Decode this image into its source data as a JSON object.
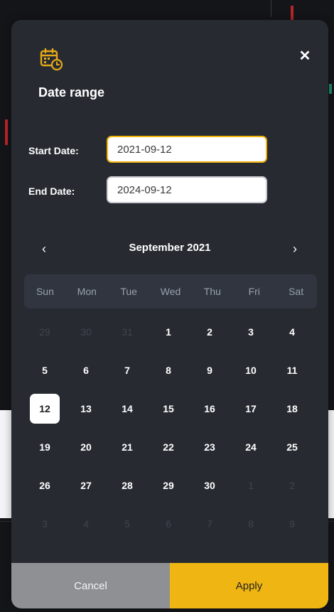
{
  "dialog": {
    "title": "Date range",
    "close_symbol": "✕",
    "icon": "calendar-clock-icon",
    "accent_color": "#f0b30d"
  },
  "start_date": {
    "label": "Start Date:",
    "value": "2021-09-12"
  },
  "end_date": {
    "label": "End Date:",
    "value": "2024-09-12"
  },
  "calendar": {
    "month_label": "September 2021",
    "prev_symbol": "‹",
    "next_symbol": "›",
    "weekdays": [
      "Sun",
      "Mon",
      "Tue",
      "Wed",
      "Thu",
      "Fri",
      "Sat"
    ],
    "weeks": [
      [
        "29",
        "30",
        "31",
        "1",
        "2",
        "3",
        "4"
      ],
      [
        "5",
        "6",
        "7",
        "8",
        "9",
        "10",
        "11"
      ],
      [
        "12",
        "13",
        "14",
        "15",
        "16",
        "17",
        "18"
      ],
      [
        "19",
        "20",
        "21",
        "22",
        "23",
        "24",
        "25"
      ],
      [
        "26",
        "27",
        "28",
        "29",
        "30",
        "1",
        "2"
      ],
      [
        "3",
        "4",
        "5",
        "6",
        "7",
        "8",
        "9"
      ]
    ],
    "muted": [
      [
        true,
        true,
        true,
        false,
        false,
        false,
        false
      ],
      [
        false,
        false,
        false,
        false,
        false,
        false,
        false
      ],
      [
        false,
        false,
        false,
        false,
        false,
        false,
        false
      ],
      [
        false,
        false,
        false,
        false,
        false,
        false,
        false
      ],
      [
        false,
        false,
        false,
        false,
        false,
        true,
        true
      ],
      [
        true,
        true,
        true,
        true,
        true,
        true,
        true
      ]
    ],
    "selected_day": "12"
  },
  "buttons": {
    "cancel": "Cancel",
    "apply": "Apply"
  }
}
